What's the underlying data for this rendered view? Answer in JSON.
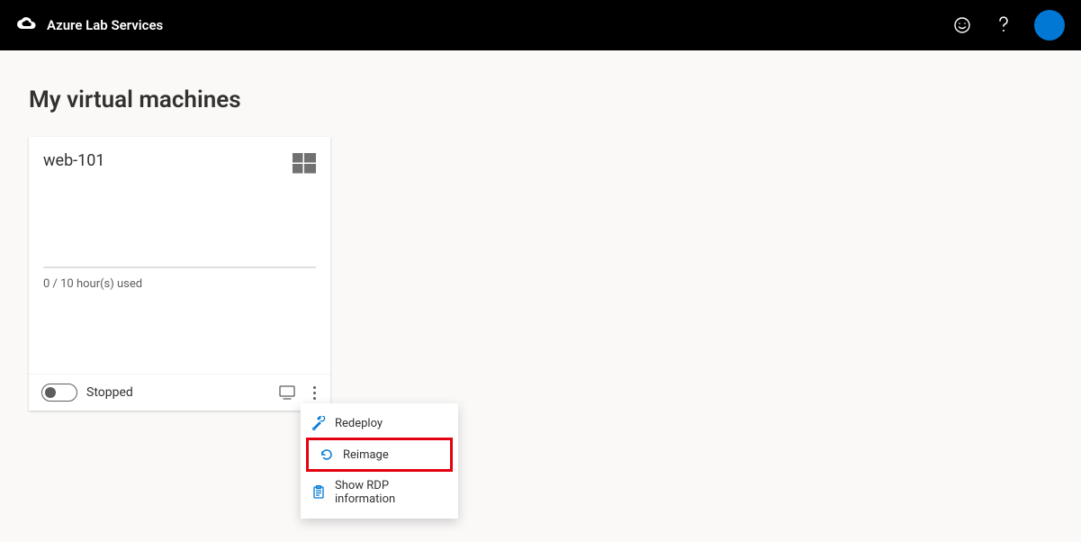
{
  "header": {
    "title": "Azure Lab Services"
  },
  "page": {
    "title": "My virtual machines"
  },
  "vm": {
    "name": "web-101",
    "usage": "0 / 10 hour(s) used",
    "status": "Stopped"
  },
  "menu": {
    "redeploy": "Redeploy",
    "reimage": "Reimage",
    "show_rdp": "Show RDP information"
  }
}
